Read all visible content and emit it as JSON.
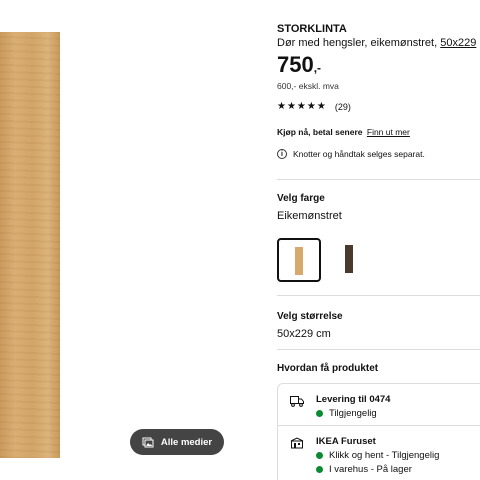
{
  "gallery": {
    "media_button_label": "Alle medier"
  },
  "product": {
    "name": "STORKLINTA",
    "description": "Dør med hengsler, eikemønstret, ",
    "size_link": "50x229",
    "price_main": "750",
    "price_suffix": ",-",
    "price_excl": "600,- ekskl. mva",
    "stars": "★★★★★",
    "rating_count": "(29)",
    "buy_now_bold": "Kjøp nå, betal senere",
    "buy_now_link": "Finn ut mer",
    "note": "Knotter og håndtak selges separat."
  },
  "color": {
    "title": "Velg farge",
    "value": "Eikemønstret",
    "swatches": [
      {
        "name": "Eikemønstret",
        "color": "#d7aa6c",
        "selected": true
      },
      {
        "name": "dark",
        "color": "#4a3a2e",
        "selected": false
      }
    ]
  },
  "size": {
    "title": "Velg størrelse",
    "value": "50x229 cm"
  },
  "delivery": {
    "title": "Hvordan få produktet",
    "options": [
      {
        "head": "Levering til 0474",
        "statuses": [
          "Tilgjengelig"
        ]
      },
      {
        "head": "IKEA Furuset",
        "statuses": [
          "Klikk og hent - Tilgjengelig",
          "I varehus - På lager"
        ]
      }
    ],
    "status_color": "#0a8a32"
  }
}
